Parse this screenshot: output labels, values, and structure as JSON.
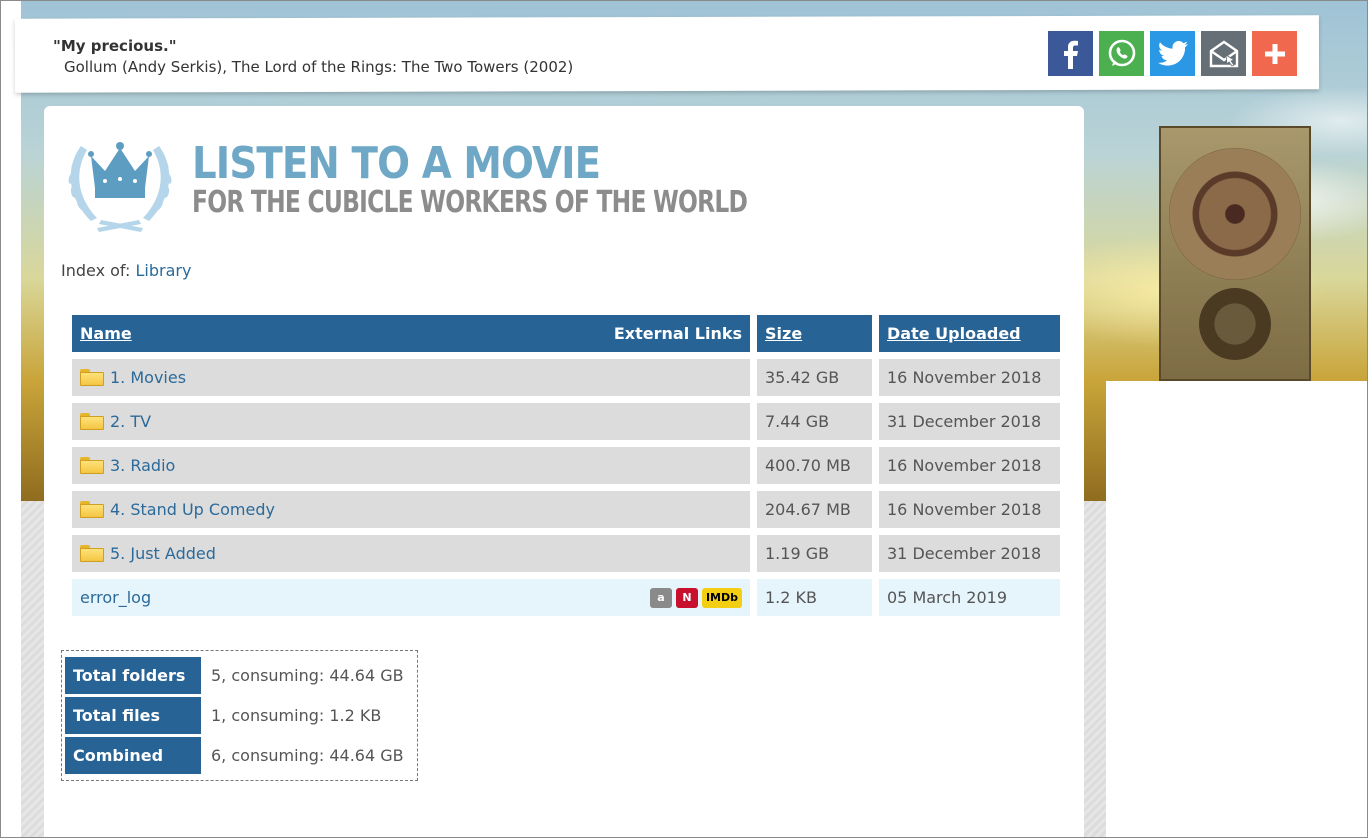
{
  "quote": {
    "line": "\"My precious.\"",
    "attribution": "Gollum (Andy Serkis), The Lord of the Rings: The Two Towers (2002)"
  },
  "share": [
    {
      "icon": "facebook-icon",
      "color": "#3b5998"
    },
    {
      "icon": "whatsapp-icon",
      "color": "#4caf50"
    },
    {
      "icon": "twitter-icon",
      "color": "#2b98e6"
    },
    {
      "icon": "email-icon",
      "color": "#666e76"
    },
    {
      "icon": "plus-icon",
      "color": "#f0684e"
    }
  ],
  "logo": {
    "title": "LISTEN TO A MOVIE",
    "subtitle": "FOR THE CUBICLE WORKERS OF THE WORLD"
  },
  "index": {
    "label": "Index of:",
    "path": "Library"
  },
  "table": {
    "headers": {
      "name": "Name",
      "external": "External Links",
      "size": "Size",
      "date": "Date Uploaded"
    },
    "rows": [
      {
        "name": "1. Movies",
        "size": "35.42 GB",
        "date": "16 November 2018"
      },
      {
        "name": "2. TV",
        "size": "7.44 GB",
        "date": "31 December 2018"
      },
      {
        "name": "3. Radio",
        "size": "400.70 MB",
        "date": "16 November 2018"
      },
      {
        "name": "4. Stand Up Comedy",
        "size": "204.67 MB",
        "date": "16 November 2018"
      },
      {
        "name": "5. Just Added",
        "size": "1.19 GB",
        "date": "31 December 2018"
      }
    ],
    "file": {
      "name": "error_log",
      "size": "1.2 KB",
      "date": "05 March 2019",
      "ext": {
        "amazon": "a",
        "netflix": "N",
        "imdb": "IMDb"
      }
    }
  },
  "summary": [
    {
      "label": "Total folders",
      "value": "5, consuming: 44.64 GB"
    },
    {
      "label": "Total files",
      "value": "1, consuming: 1.2 KB"
    },
    {
      "label": "Combined",
      "value": "6, consuming: 44.64 GB"
    }
  ]
}
